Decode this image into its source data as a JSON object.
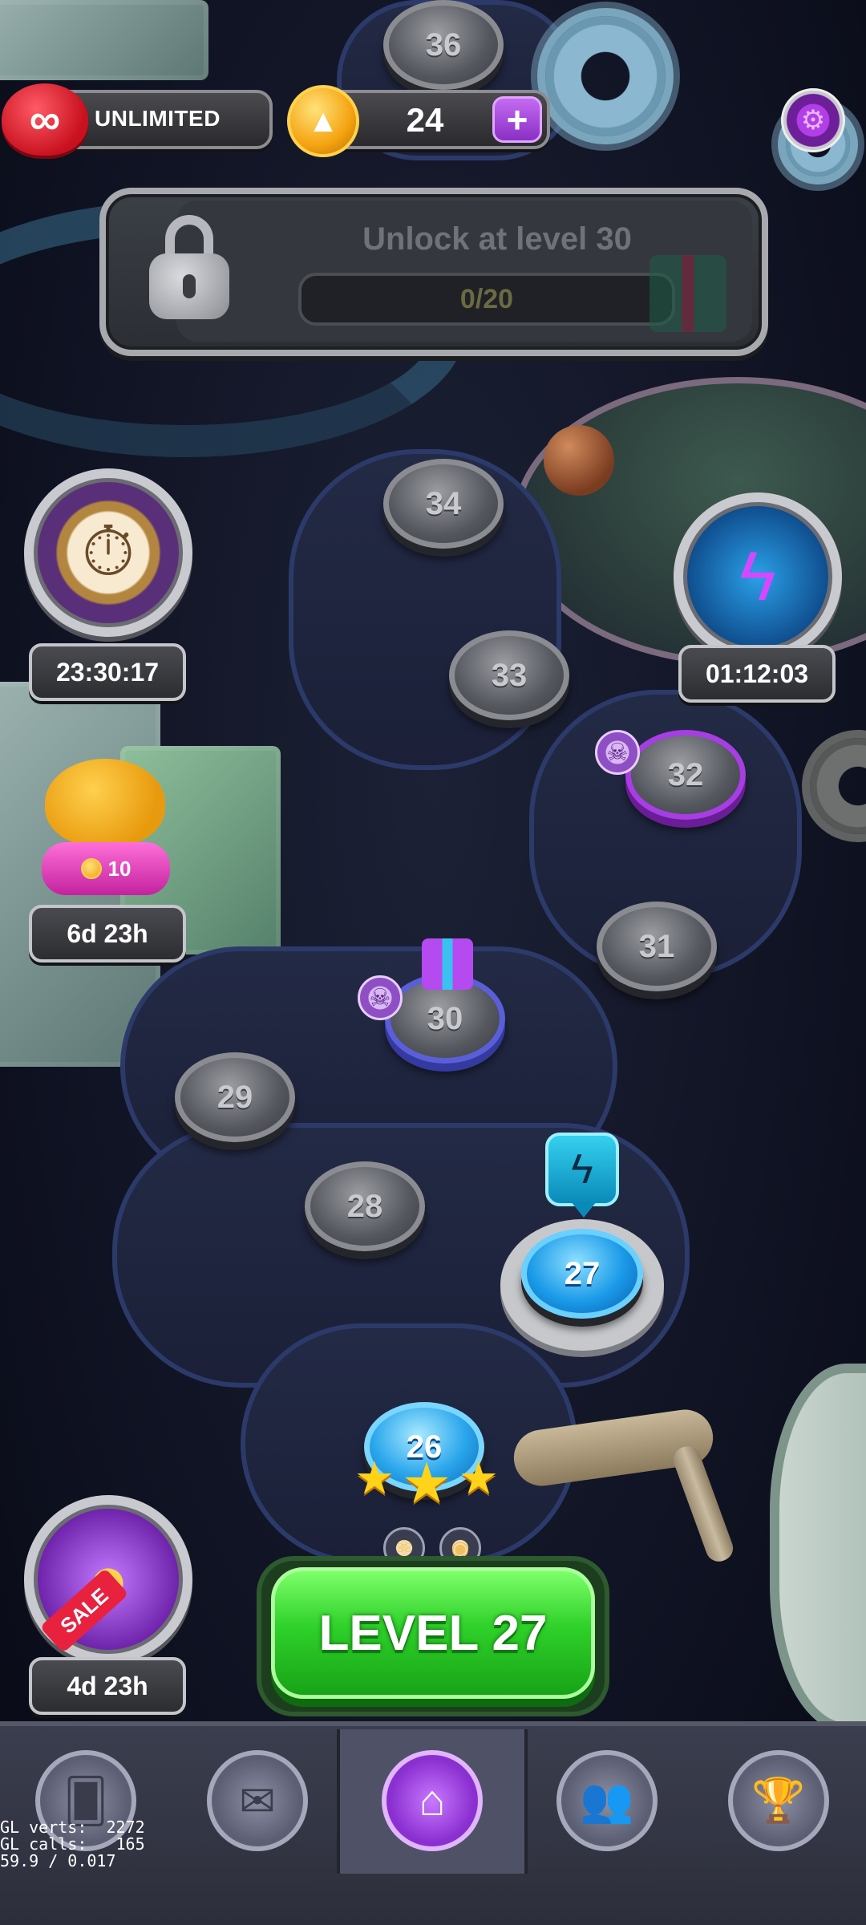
{
  "hud": {
    "lives_label": "UNLIMITED",
    "lives_icon": "infinity-heart-icon",
    "coins_value": "24",
    "coins_plus": "+",
    "coin_icon": "coin-icon",
    "settings_icon": "gear-icon"
  },
  "unlock_banner": {
    "title": "Unlock at level 30",
    "progress": "0/20",
    "progress_value": 0,
    "progress_max": 20,
    "lock_icon": "padlock-icon",
    "reward_icon": "gift-icon"
  },
  "side_widgets": {
    "clock_timer": "23:30:17",
    "energy_timer": "01:12:03",
    "piggy_bank_coins": "10",
    "piggy_timer": "6d 23h",
    "sale_label": "SALE",
    "sale_timer": "4d 23h"
  },
  "map": {
    "levels": {
      "l26": "26",
      "l27": "27",
      "l28": "28",
      "l29": "29",
      "l30": "30",
      "l31": "31",
      "l32": "32",
      "l33": "33",
      "l34": "34",
      "l36": "36"
    },
    "completed_level_stars": 3,
    "current_level": 27,
    "locked_levels": [
      28,
      29,
      30,
      31,
      32,
      33,
      34,
      36
    ],
    "hard_levels": [
      30,
      32
    ]
  },
  "play_button": {
    "label": "LEVEL 27"
  },
  "nav": {
    "items": [
      {
        "name": "cards",
        "icon": "cards-icon",
        "glyph": "🂠",
        "active": false
      },
      {
        "name": "mail",
        "icon": "envelope-icon",
        "glyph": "✉",
        "active": false
      },
      {
        "name": "home",
        "icon": "home-icon",
        "glyph": "⌂",
        "active": true
      },
      {
        "name": "team",
        "icon": "team-icon",
        "glyph": "👥",
        "active": false
      },
      {
        "name": "leaderboard",
        "icon": "trophy-icon",
        "glyph": "🏆",
        "active": false
      }
    ]
  },
  "debug": {
    "line1": "GL verts:  2272",
    "line2": "GL calls:   165",
    "line3": "59.9 / 0.017"
  },
  "colors": {
    "accent_green": "#2fd12a",
    "accent_purple": "#8a2fc4",
    "current_level_blue": "#1a9ae8"
  }
}
